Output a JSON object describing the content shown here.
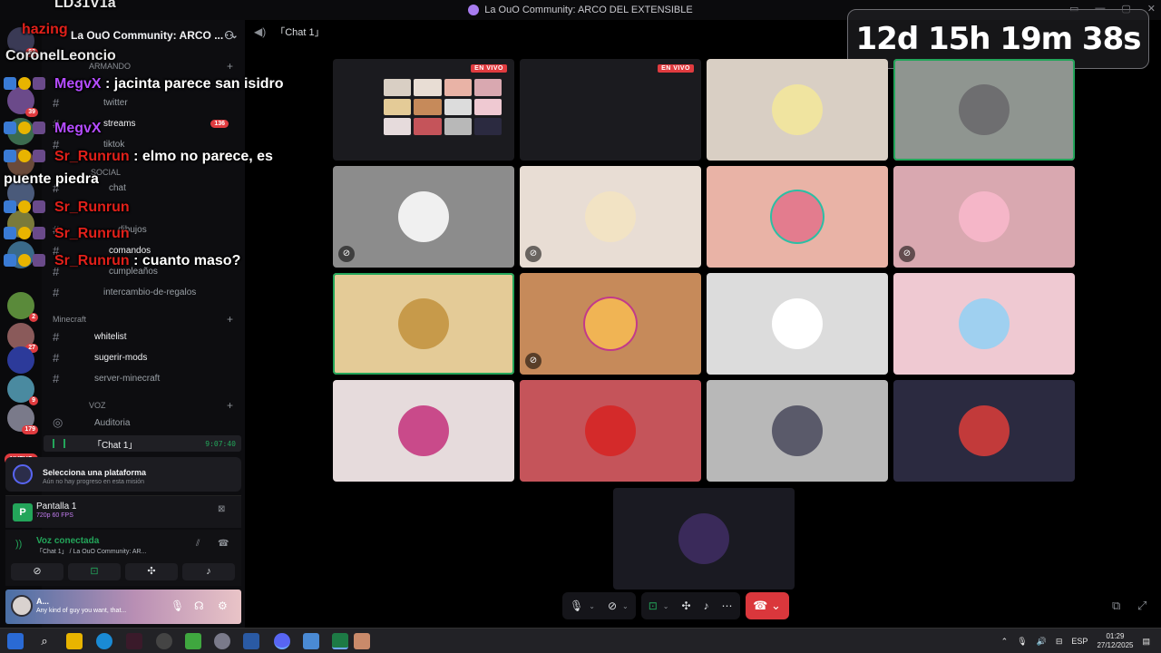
{
  "window": {
    "title": "La OuO Community: ARCO DEL EXTENSIBLE"
  },
  "server": {
    "name": "La OuO Community: ARCO ...",
    "badges": [
      "62",
      "39",
      "136",
      "2",
      "27",
      "9",
      "179"
    ],
    "nuevo_label": "NUEVO"
  },
  "sidebar": {
    "categories": {
      "armando": "ARMANDO",
      "social": "SOCIAL",
      "minecraft": "Minecraft",
      "voz": "VOZ"
    },
    "channels": {
      "twitter": "twitter",
      "streams": "streams",
      "streams_mentions": "136",
      "tiktok": "tiktok",
      "chat": "chat",
      "dibujos": "dibujos",
      "comandos": "comandos",
      "cumpleanos": "cumpleaños",
      "intercambio": "intercambio-de-regalos",
      "whitelist": "whitelist",
      "sugerir_mods": "sugerir-mods",
      "server_minecraft": "server-minecraft",
      "auditoria": "Auditoria"
    },
    "active_voice": {
      "name": "「Chat 1」",
      "timer": "9:07:40"
    }
  },
  "quest": {
    "title": "Selecciona una plataforma",
    "subtitle": "Aún no hay progreso en esta misión"
  },
  "screen_share": {
    "icon_letter": "P",
    "title": "Pantalla 1",
    "subtitle": "720p 60 FPS"
  },
  "voice_status": {
    "status": "Voz conectada",
    "channel": "「Chat 1」 / La OuO Community: AR..."
  },
  "user": {
    "name": "A...",
    "status": "Any kind of guy you want, that..."
  },
  "chat_overlay": {
    "lines": [
      {
        "name": "LD31V1a",
        "msg": ""
      },
      {
        "name": "hazing",
        "msg": ""
      },
      {
        "name": "CoronelLeoncio",
        "msg": ""
      },
      {
        "name": "MegvX",
        "msg": "jacinta parece san isidro"
      },
      {
        "name": "MegvX",
        "msg": ""
      },
      {
        "name": "Sr_Runrun",
        "msg": "elmo no parece, es"
      },
      {
        "name": "",
        "msg": "puente piedra"
      },
      {
        "name": "Sr_Runrun",
        "msg": ""
      },
      {
        "name": "Sr_Runrun",
        "msg": ""
      },
      {
        "name": "Sr_Runrun",
        "msg": "cuanto maso?"
      }
    ]
  },
  "voice_header": {
    "channel": "「Chat 1」"
  },
  "countdown": {
    "text": "12d 15h 19m 38s"
  },
  "live_label": "EN VIVO",
  "colors": {
    "accent_green": "#23a55a",
    "live_red": "#e03b3f",
    "end_call": "#da373c",
    "tile_colors": [
      "#1b1b1f",
      "#1b1b1f",
      "#d9cfc4",
      "#8f9590",
      "#8c8c8c",
      "#e8ddd4",
      "#e9b3a6",
      "#d9a8b0",
      "#e4cb97",
      "#c68a5a",
      "#dcdcdc",
      "#efc9d2",
      "#e6dbdc",
      "#c5545a",
      "#b8b8b8",
      "#2b2a40",
      "#1a1a22"
    ]
  },
  "taskbar": {
    "language": "ESP",
    "time": "01:29",
    "date": "27/12/2025"
  }
}
